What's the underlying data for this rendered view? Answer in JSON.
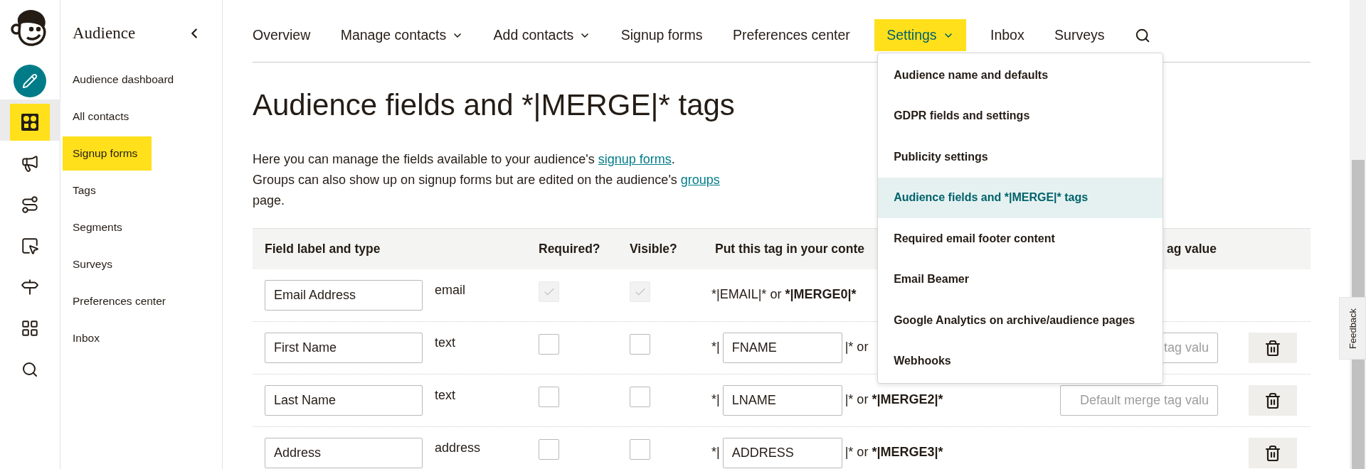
{
  "icon_rail": {
    "items": [
      {
        "kind": "create",
        "selected": false
      },
      {
        "kind": "audience",
        "selected": true
      },
      {
        "kind": "campaigns",
        "selected": false
      },
      {
        "kind": "automations",
        "selected": false
      },
      {
        "kind": "website",
        "selected": false
      },
      {
        "kind": "content",
        "selected": false
      },
      {
        "kind": "integrations",
        "selected": false
      },
      {
        "kind": "search",
        "selected": false
      }
    ]
  },
  "sidebar": {
    "title": "Audience",
    "items": [
      {
        "label": "Audience dashboard",
        "selected": false
      },
      {
        "label": "All contacts",
        "selected": false
      },
      {
        "label": "Signup forms",
        "selected": true
      },
      {
        "label": "Tags",
        "selected": false
      },
      {
        "label": "Segments",
        "selected": false
      },
      {
        "label": "Surveys",
        "selected": false
      },
      {
        "label": "Preferences center",
        "selected": false
      },
      {
        "label": "Inbox",
        "selected": false
      }
    ]
  },
  "nav": {
    "items": [
      {
        "label": "Overview",
        "has_menu": false,
        "selected": false
      },
      {
        "label": "Manage contacts",
        "has_menu": true,
        "selected": false
      },
      {
        "label": "Add contacts",
        "has_menu": true,
        "selected": false
      },
      {
        "label": "Signup forms",
        "has_menu": false,
        "selected": false
      },
      {
        "label": "Preferences center",
        "has_menu": false,
        "selected": false
      },
      {
        "label": "Settings",
        "has_menu": true,
        "selected": true
      },
      {
        "label": "Inbox",
        "has_menu": false,
        "selected": false
      },
      {
        "label": "Surveys",
        "has_menu": false,
        "selected": false
      }
    ],
    "menu": {
      "items": [
        {
          "label": "Audience name and defaults",
          "selected": false
        },
        {
          "label": "GDPR fields and settings",
          "selected": false
        },
        {
          "label": "Publicity settings",
          "selected": false
        },
        {
          "label": "Audience fields and *|MERGE|* tags",
          "selected": true
        },
        {
          "label": "Required email footer content",
          "selected": false
        },
        {
          "label": "Email Beamer",
          "selected": false
        },
        {
          "label": "Google Analytics on archive/audience pages",
          "selected": false
        },
        {
          "label": "Webhooks",
          "selected": false
        }
      ]
    }
  },
  "page_title": "Audience fields and *|MERGE|* tags",
  "intro": {
    "parts": [
      {
        "kind": "text",
        "text": "Here you can manage the fields available to your audience's "
      },
      {
        "kind": "link",
        "text": "signup forms"
      },
      {
        "kind": "text",
        "text": "."
      },
      {
        "kind": "break"
      },
      {
        "kind": "text",
        "text": "Groups can also show up on signup forms but are edited on the audience's "
      },
      {
        "kind": "link",
        "text": "groups"
      },
      {
        "kind": "break"
      },
      {
        "kind": "text",
        "text": "page."
      }
    ]
  },
  "table": {
    "columns": [
      "Field label and type",
      "Required?",
      "Visible?",
      "Put this tag in your conte",
      "ag value"
    ],
    "rows": [
      {
        "kind": "fixed",
        "label": "Email Address",
        "type": "email",
        "required": true,
        "visible": true,
        "disabled": true,
        "tag_text": "*|EMAIL|* or ",
        "bold_tag": "*|MERGE0|*"
      },
      {
        "kind": "editable",
        "label": "First Name",
        "type": "text",
        "required": false,
        "visible": false,
        "disabled": false,
        "tag_prefix": "*|",
        "tag": "FNAME",
        "tag_suffix": "|* or",
        "default_placeholder": "tag valu"
      },
      {
        "kind": "editable",
        "label": "Last Name",
        "type": "text",
        "required": false,
        "visible": false,
        "disabled": false,
        "tag_prefix": "*|",
        "tag": "LNAME",
        "tag_suffix": "|* or ",
        "merge": "*|MERGE2|*",
        "default_placeholder": "Default merge tag valu"
      },
      {
        "kind": "editable",
        "label": "Address",
        "type": "address",
        "required": false,
        "visible": false,
        "disabled": false,
        "tag_prefix": "*|",
        "tag": "ADDRESS",
        "tag_suffix": "|* or ",
        "merge": "*|MERGE3|*"
      }
    ]
  },
  "feedback": {
    "label": "Feedback"
  }
}
